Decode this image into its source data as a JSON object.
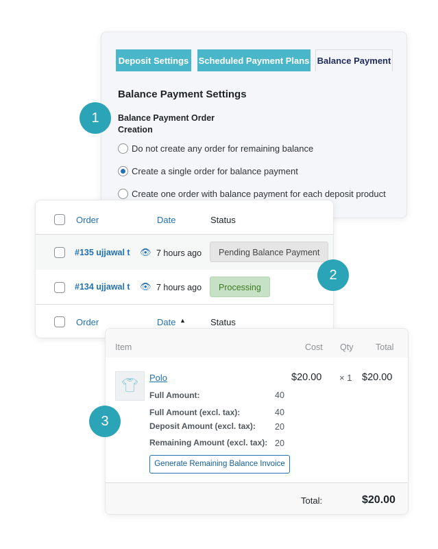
{
  "settings": {
    "tabs": [
      {
        "label": "Deposit Settings"
      },
      {
        "label": "Scheduled Payment Plans"
      },
      {
        "label": "Balance Payment"
      }
    ],
    "title": "Balance Payment Settings",
    "field_label_1": "Balance Payment Order",
    "field_label_2": "Creation",
    "options": [
      {
        "label": "Do not create any order for remaining balance",
        "checked": false
      },
      {
        "label": "Create a single order for balance payment",
        "checked": true
      },
      {
        "label": "Create one order with balance payment for each deposit product",
        "checked": false
      }
    ]
  },
  "orders": {
    "columns": {
      "order": "Order",
      "date": "Date",
      "status": "Status"
    },
    "rows": [
      {
        "order": "#135 ujjawal t",
        "date": "7 hours ago",
        "status": "Pending Balance Payment"
      },
      {
        "order": "#134 ujjawal t",
        "date": "7 hours ago",
        "status": "Processing"
      }
    ],
    "sort_indicator": "▲"
  },
  "items": {
    "columns": {
      "item": "Item",
      "cost": "Cost",
      "qty": "Qty",
      "total": "Total"
    },
    "product": {
      "name": "Polo",
      "cost": "$20.00",
      "qty": "× 1",
      "total": "$20.00",
      "meta": [
        {
          "label": "Full Amount:",
          "value": "40"
        },
        {
          "label": "Full Amount (excl. tax):",
          "value": "40"
        },
        {
          "label": "Deposit Amount (excl. tax):",
          "value": "20"
        },
        {
          "label": "Remaining Amount (excl. tax):",
          "value": "20"
        }
      ]
    },
    "button": "Generate Remaining Balance Invoice",
    "total_label": "Total:",
    "total_value": "$20.00"
  },
  "steps": [
    "1",
    "2",
    "3"
  ],
  "colors": {
    "accent": "#2ba4b7",
    "tab": "#4ab6c9",
    "link": "#2271b1"
  }
}
